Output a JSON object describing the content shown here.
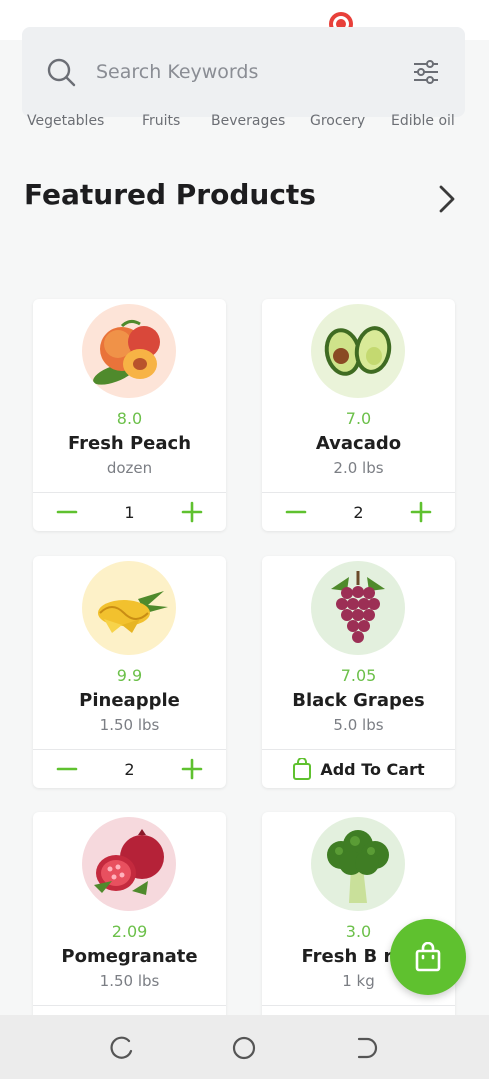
{
  "search": {
    "placeholder": "Search Keywords"
  },
  "categories": [
    "Vegetables",
    "Fruits",
    "Beverages",
    "Grocery",
    "Edible oil"
  ],
  "section": {
    "title": "Featured Products"
  },
  "products": [
    {
      "price": "8.0",
      "name": "Fresh Peach",
      "unit": "dozen",
      "qty": "1"
    },
    {
      "price": "7.0",
      "name": "Avacado",
      "unit": "2.0 lbs",
      "qty": "2"
    },
    {
      "price": "9.9",
      "name": "Pineapple",
      "unit": "1.50 lbs",
      "qty": "2"
    },
    {
      "price": "7.05",
      "name": "Black Grapes",
      "unit": "5.0 lbs",
      "cta": "Add To Cart"
    },
    {
      "price": "2.09",
      "name": "Pomegranate",
      "unit": "1.50 lbs"
    },
    {
      "price": "3.0",
      "name": "Fresh B roc",
      "unit": "1 kg"
    }
  ],
  "icons": {
    "search": "search-icon",
    "filter": "filter-icon",
    "chevron": "chevron-right-icon",
    "minus": "minus-icon",
    "plus": "plus-icon",
    "bag": "shopping-bag-icon",
    "recent": "recent-apps-icon",
    "home": "home-icon",
    "back": "back-icon"
  },
  "colors": {
    "accent": "#6cc04a",
    "fab": "#5fc12f",
    "recording": "#e8403a"
  }
}
